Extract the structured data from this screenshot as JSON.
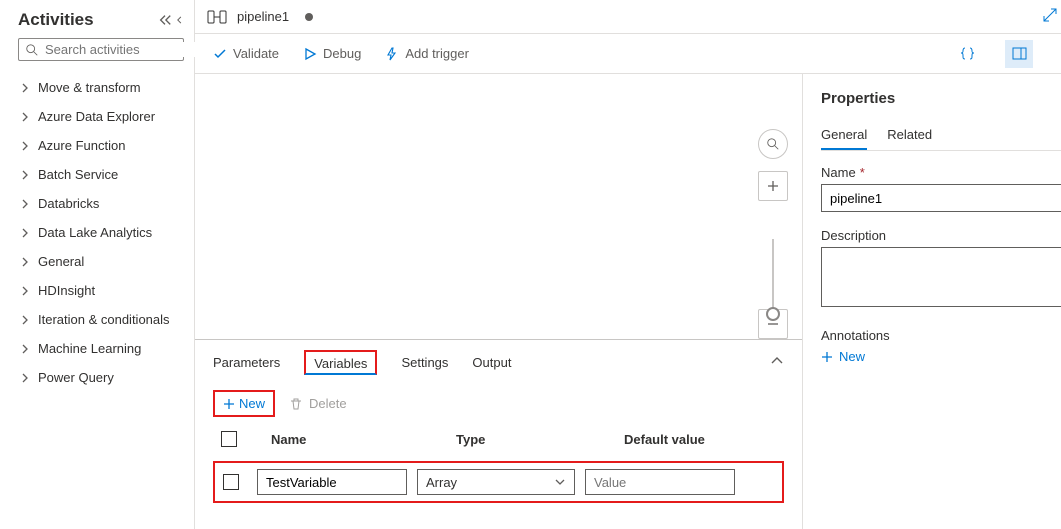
{
  "sidebar": {
    "title": "Activities",
    "search_placeholder": "Search activities",
    "items": [
      "Move & transform",
      "Azure Data Explorer",
      "Azure Function",
      "Batch Service",
      "Databricks",
      "Data Lake Analytics",
      "General",
      "HDInsight",
      "Iteration & conditionals",
      "Machine Learning",
      "Power Query"
    ]
  },
  "tab": {
    "name": "pipeline1"
  },
  "toolbar": {
    "validate": "Validate",
    "debug": "Debug",
    "add_trigger": "Add trigger"
  },
  "footer": {
    "tabs": {
      "parameters": "Parameters",
      "variables": "Variables",
      "settings": "Settings",
      "output": "Output"
    },
    "new": "New",
    "delete": "Delete",
    "columns": {
      "name": "Name",
      "type": "Type",
      "default": "Default value"
    },
    "row": {
      "name": "TestVariable",
      "type": "Array",
      "default_placeholder": "Value"
    }
  },
  "props": {
    "title": "Properties",
    "tabs": {
      "general": "General",
      "related": "Related"
    },
    "name_label": "Name",
    "name_value": "pipeline1",
    "description_label": "Description",
    "annotations_label": "Annotations",
    "new": "New"
  }
}
